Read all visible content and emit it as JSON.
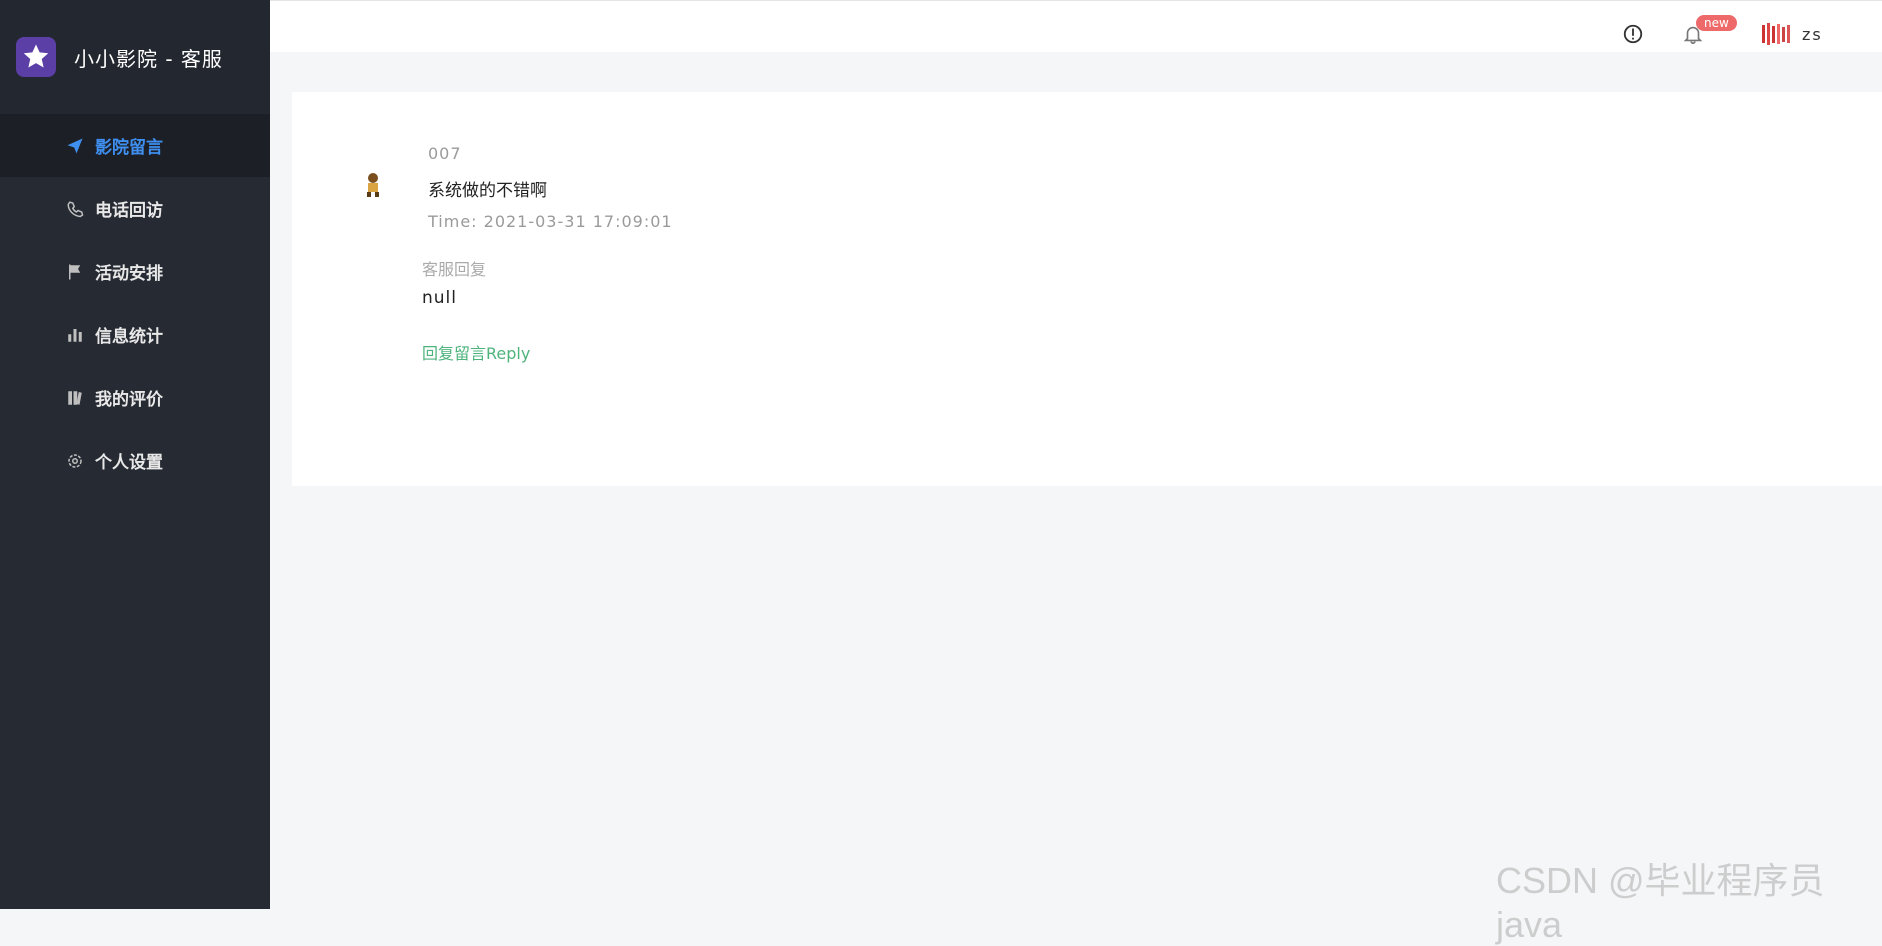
{
  "brand": {
    "title": "小小影院 - 客服",
    "logo_icon": "star-icon",
    "logo_color": "#5b3fa6"
  },
  "sidebar": {
    "items": [
      {
        "label": "影院留言",
        "icon": "paper-plane-icon",
        "active": true
      },
      {
        "label": "电话回访",
        "icon": "phone-icon",
        "active": false
      },
      {
        "label": "活动安排",
        "icon": "flag-icon",
        "active": false
      },
      {
        "label": "信息统计",
        "icon": "bar-chart-icon",
        "active": false
      },
      {
        "label": "我的评价",
        "icon": "book-icon",
        "active": false
      },
      {
        "label": "个人设置",
        "icon": "gear-icon",
        "active": false
      }
    ]
  },
  "header": {
    "badge": "new",
    "username": "zs"
  },
  "message": {
    "user": "007",
    "content": "系统做的不错啊",
    "time": "Time: 2021-03-31 17:09:01",
    "reply_label": "客服回复",
    "reply_value": "null",
    "reply_link": "回复留言Reply"
  },
  "watermark": "CSDN @毕业程序员java",
  "colors": {
    "sidebar_bg": "#262a33",
    "active_text": "#3f8ff0",
    "reply_link": "#4fb37c",
    "badge": "#ee6a6a"
  }
}
